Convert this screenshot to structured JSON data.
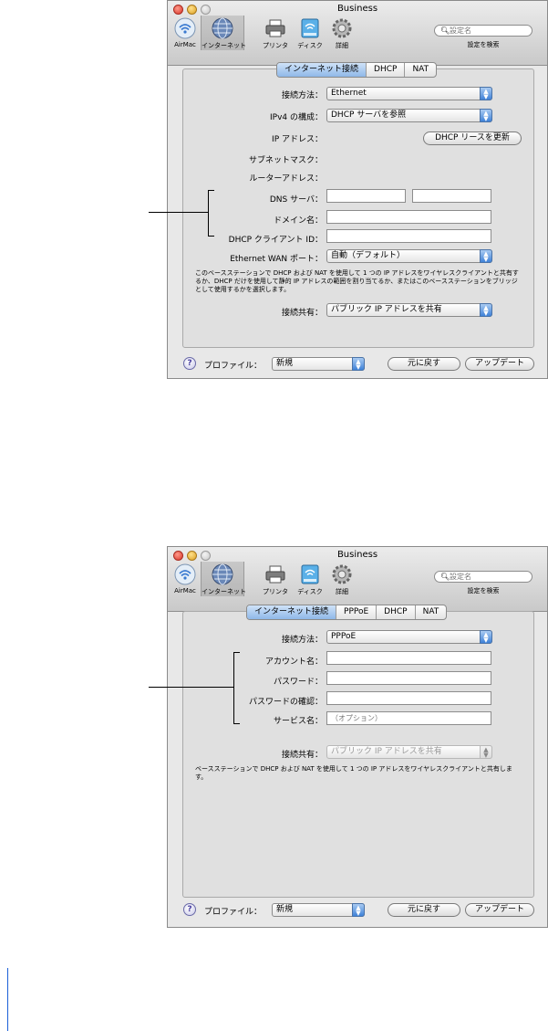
{
  "window1": {
    "title": "Business",
    "toolbar": [
      {
        "label": "AirMac",
        "icon": "airmac-icon"
      },
      {
        "label": "インターネット",
        "icon": "globe-icon"
      },
      {
        "label": "プリンタ",
        "icon": "printer-icon"
      },
      {
        "label": "ディスク",
        "icon": "disk-icon"
      },
      {
        "label": "詳細",
        "icon": "gear-icon"
      }
    ],
    "search": {
      "placeholder": "設定名",
      "label": "設定を検索"
    },
    "tabs": [
      "インターネット接続",
      "DHCP",
      "NAT"
    ],
    "connection_method": {
      "label": "接続方法：",
      "value": "Ethernet"
    },
    "ipv4": {
      "label": "IPv4 の構成：",
      "value": "DHCP サーバを参照"
    },
    "ip_address": {
      "label": "IP アドレス："
    },
    "renew_button": "DHCP リースを更新",
    "subnet_mask": {
      "label": "サブネットマスク："
    },
    "router_address": {
      "label": "ルーターアドレス："
    },
    "dns": {
      "label": "DNS サーバ：",
      "value1": "",
      "value2": ""
    },
    "domain": {
      "label": "ドメイン名：",
      "value": ""
    },
    "client_id": {
      "label": "DHCP クライアント ID：",
      "value": ""
    },
    "wan_port": {
      "label": "Ethernet WAN ポート：",
      "value": "自動（デフォルト）"
    },
    "description": "このベースステーションで DHCP および NAT を使用して 1 つの IP アドレスをワイヤレスクライアントと共有するか、DHCP だけを使用して静的 IP アドレスの範囲を割り当てるか、またはこのベースステーションをブリッジとして使用するかを選択します。",
    "sharing": {
      "label": "接続共有：",
      "value": "パブリック IP アドレスを共有"
    },
    "footer": {
      "profile_label": "プロファイル：",
      "profile_value": "新規",
      "revert": "元に戻す",
      "update": "アップデート"
    }
  },
  "window2": {
    "title": "Business",
    "toolbar": [
      {
        "label": "AirMac",
        "icon": "airmac-icon"
      },
      {
        "label": "インターネット",
        "icon": "globe-icon"
      },
      {
        "label": "プリンタ",
        "icon": "printer-icon"
      },
      {
        "label": "ディスク",
        "icon": "disk-icon"
      },
      {
        "label": "詳細",
        "icon": "gear-icon"
      }
    ],
    "search": {
      "placeholder": "設定名",
      "label": "設定を検索"
    },
    "tabs": [
      "インターネット接続",
      "PPPoE",
      "DHCP",
      "NAT"
    ],
    "connection_method": {
      "label": "接続方法：",
      "value": "PPPoE"
    },
    "account": {
      "label": "アカウント名：",
      "value": ""
    },
    "password": {
      "label": "パスワード：",
      "value": ""
    },
    "password_confirm": {
      "label": "パスワードの確認：",
      "value": ""
    },
    "service": {
      "label": "サービス名：",
      "placeholder": "（オプション）"
    },
    "sharing": {
      "label": "接続共有：",
      "value": "パブリック IP アドレスを共有"
    },
    "description": "ベースステーションで DHCP および NAT を使用して 1 つの IP アドレスをワイヤレスクライアントと共有します。",
    "footer": {
      "profile_label": "プロファイル：",
      "profile_value": "新規",
      "revert": "元に戻す",
      "update": "アップデート"
    }
  }
}
